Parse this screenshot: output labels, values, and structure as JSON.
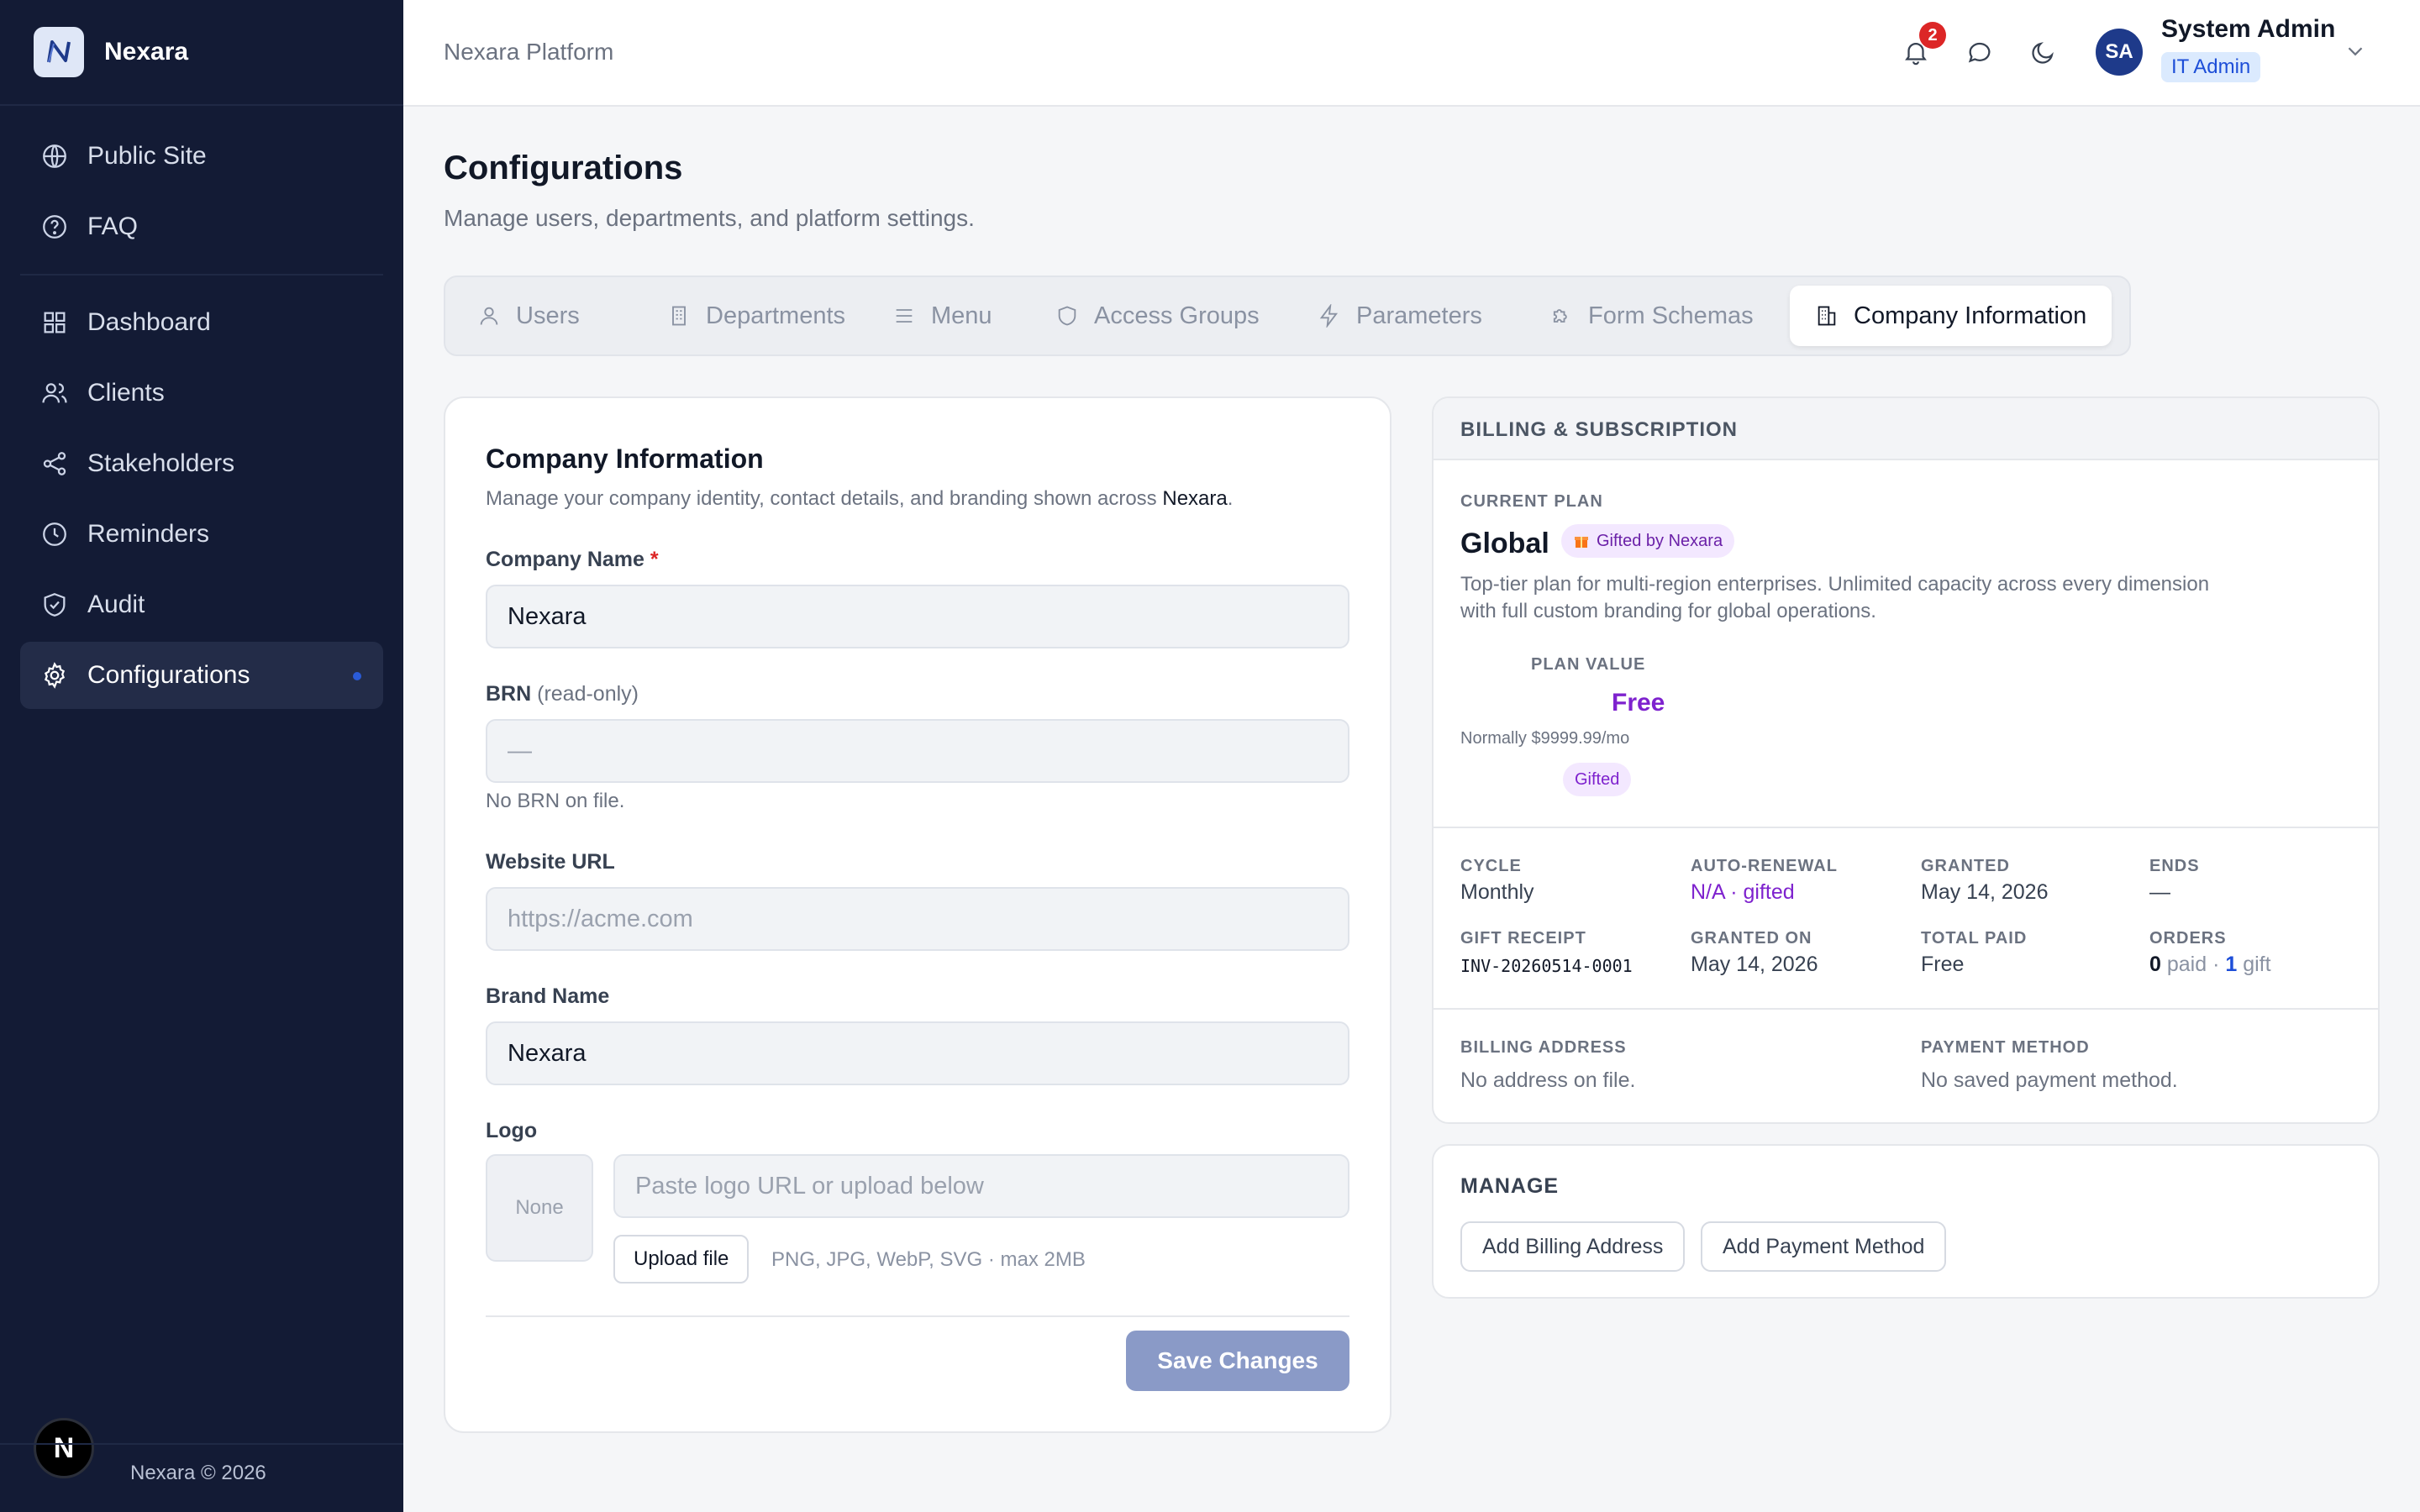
{
  "app": {
    "name": "Nexara",
    "footer": "Nexara © 2026",
    "fab_letter": "N"
  },
  "sidebar": {
    "top_items": [
      {
        "label": "Public Site",
        "icon": "globe-icon"
      },
      {
        "label": "FAQ",
        "icon": "help-circle-icon"
      }
    ],
    "main_items": [
      {
        "label": "Dashboard",
        "icon": "grid-icon"
      },
      {
        "label": "Clients",
        "icon": "users-icon"
      },
      {
        "label": "Stakeholders",
        "icon": "share-icon"
      },
      {
        "label": "Reminders",
        "icon": "clock-icon"
      },
      {
        "label": "Audit",
        "icon": "shield-check-icon"
      },
      {
        "label": "Configurations",
        "icon": "gear-icon",
        "active": true
      }
    ]
  },
  "header": {
    "title": "Nexara Platform",
    "notification_count": "2",
    "user": {
      "initials": "SA",
      "name": "System Admin",
      "role": "IT Admin"
    }
  },
  "page": {
    "title": "Configurations",
    "subtitle": "Manage users, departments, and platform settings."
  },
  "tabs": [
    {
      "label": "Users",
      "icon": "user-icon"
    },
    {
      "label": "Departments",
      "icon": "building-icon"
    },
    {
      "label": "Menu",
      "icon": "menu-icon"
    },
    {
      "label": "Access Groups",
      "icon": "shield-icon"
    },
    {
      "label": "Parameters",
      "icon": "bolt-icon"
    },
    {
      "label": "Form Schemas",
      "icon": "puzzle-icon"
    },
    {
      "label": "Company Information",
      "icon": "office-icon",
      "active": true
    }
  ],
  "company": {
    "title": "Company Information",
    "subtitle_prefix": "Manage your company identity, contact details, and branding shown across ",
    "subtitle_brand": "Nexara",
    "subtitle_suffix": ".",
    "company_name": {
      "label": "Company Name",
      "required": "*",
      "value": "Nexara"
    },
    "brn": {
      "label": "BRN",
      "note": "(read-only)",
      "value": "—",
      "help": "No BRN on file."
    },
    "website": {
      "label": "Website URL",
      "placeholder": "https://acme.com"
    },
    "brand": {
      "label": "Brand Name",
      "value": "Nexara"
    },
    "logo": {
      "label": "Logo",
      "preview": "None",
      "placeholder": "Paste logo URL or upload below",
      "upload_label": "Upload file",
      "hint": "PNG, JPG, WebP, SVG · max 2MB"
    },
    "save_label": "Save Changes"
  },
  "billing": {
    "header": "BILLING & SUBSCRIPTION",
    "current_plan_label": "CURRENT PLAN",
    "plan_name": "Global",
    "gift_chip": "Gifted by Nexara",
    "description": "Top-tier plan for multi-region enterprises. Unlimited capacity across every dimension with full custom branding for global operations.",
    "plan_value_label": "PLAN VALUE",
    "plan_value": "Free",
    "normally": "Normally $9999.99/mo",
    "gifted_pill": "Gifted",
    "stats": {
      "cycle": {
        "label": "CYCLE",
        "value": "Monthly"
      },
      "auto_renewal": {
        "label": "AUTO-RENEWAL",
        "value": "N/A · gifted"
      },
      "granted": {
        "label": "GRANTED",
        "value": "May 14, 2026"
      },
      "ends": {
        "label": "ENDS",
        "value": "—"
      },
      "gift_receipt": {
        "label": "GIFT RECEIPT",
        "value": "INV-20260514-0001"
      },
      "granted_on": {
        "label": "GRANTED ON",
        "value": "May 14, 2026"
      },
      "total_paid": {
        "label": "TOTAL PAID",
        "value": "Free"
      },
      "orders": {
        "label": "ORDERS",
        "paid_count": "0",
        "paid_label": "paid",
        "separator": "·",
        "gift_count": "1",
        "gift_label": "gift"
      }
    },
    "billing_address": {
      "label": "BILLING ADDRESS",
      "value": "No address on file."
    },
    "payment_method": {
      "label": "PAYMENT METHOD",
      "value": "No saved payment method."
    }
  },
  "manage": {
    "title": "MANAGE",
    "add_billing_label": "Add Billing Address",
    "add_payment_label": "Add Payment Method"
  },
  "colors": {
    "sidebar_bg": "#131b35",
    "accent": "#1e3a8a",
    "gift_purple": "#7e22ce",
    "save_button": "#8a9ac7"
  }
}
